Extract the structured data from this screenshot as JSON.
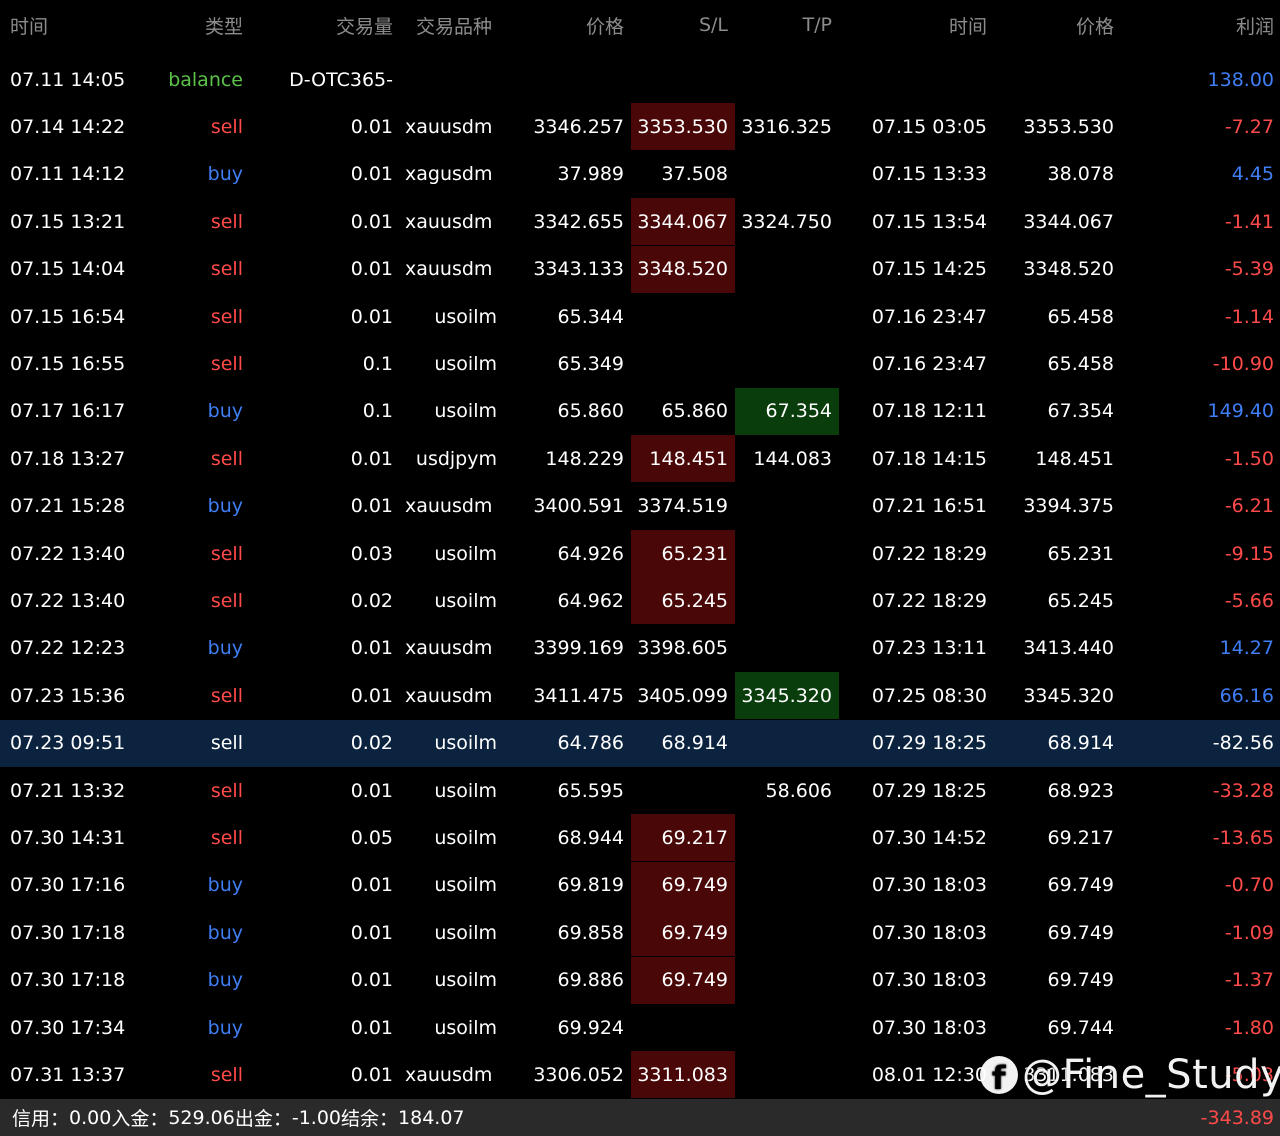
{
  "headers": {
    "time": "时间",
    "type": "类型",
    "volume": "交易量",
    "symbol": "交易品种",
    "price": "价格",
    "sl": "S/L",
    "tp": "T/P",
    "close_time": "时间",
    "close_price": "价格",
    "profit": "利润"
  },
  "colors": {
    "sell": "#ff4a4a",
    "buy": "#3f7ef5",
    "balance": "#5cc24a",
    "sl_highlight": "#4a0707",
    "tp_highlight": "#093d0c",
    "selected_row": "#0c2340"
  },
  "rows": [
    {
      "time": "07.11 14:05",
      "type": "balance",
      "volume": "",
      "symbol": "D-OTC365-",
      "price": "",
      "sl": "",
      "tp": "",
      "close_time": "",
      "close_price": "",
      "profit": "138.00",
      "type_color": "balance",
      "profit_color": "pos",
      "sl_hl": "",
      "tp_hl": "",
      "symbol_align": "right"
    },
    {
      "time": "07.14 14:22",
      "type": "sell",
      "volume": "0.01",
      "symbol": "xauusdm",
      "price": "3346.257",
      "sl": "3353.530",
      "tp": "3316.325",
      "close_time": "07.15 03:05",
      "close_price": "3353.530",
      "profit": "-7.27",
      "type_color": "sell",
      "profit_color": "neg",
      "sl_hl": "red",
      "tp_hl": "",
      "symbol_align": "left"
    },
    {
      "time": "07.11 14:12",
      "type": "buy",
      "volume": "0.01",
      "symbol": "xagusdm",
      "price": "37.989",
      "sl": "37.508",
      "tp": "",
      "close_time": "07.15 13:33",
      "close_price": "38.078",
      "profit": "4.45",
      "type_color": "buy",
      "profit_color": "pos",
      "sl_hl": "",
      "tp_hl": "",
      "symbol_align": "left"
    },
    {
      "time": "07.15 13:21",
      "type": "sell",
      "volume": "0.01",
      "symbol": "xauusdm",
      "price": "3342.655",
      "sl": "3344.067",
      "tp": "3324.750",
      "close_time": "07.15 13:54",
      "close_price": "3344.067",
      "profit": "-1.41",
      "type_color": "sell",
      "profit_color": "neg",
      "sl_hl": "red",
      "tp_hl": "",
      "symbol_align": "left"
    },
    {
      "time": "07.15 14:04",
      "type": "sell",
      "volume": "0.01",
      "symbol": "xauusdm",
      "price": "3343.133",
      "sl": "3348.520",
      "tp": "",
      "close_time": "07.15 14:25",
      "close_price": "3348.520",
      "profit": "-5.39",
      "type_color": "sell",
      "profit_color": "neg",
      "sl_hl": "red",
      "tp_hl": "",
      "symbol_align": "left"
    },
    {
      "time": "07.15 16:54",
      "type": "sell",
      "volume": "0.01",
      "symbol": "usoilm",
      "price": "65.344",
      "sl": "",
      "tp": "",
      "close_time": "07.16 23:47",
      "close_price": "65.458",
      "profit": "-1.14",
      "type_color": "sell",
      "profit_color": "neg",
      "sl_hl": "",
      "tp_hl": "",
      "symbol_align": "right"
    },
    {
      "time": "07.15 16:55",
      "type": "sell",
      "volume": "0.1",
      "symbol": "usoilm",
      "price": "65.349",
      "sl": "",
      "tp": "",
      "close_time": "07.16 23:47",
      "close_price": "65.458",
      "profit": "-10.90",
      "type_color": "sell",
      "profit_color": "neg",
      "sl_hl": "",
      "tp_hl": "",
      "symbol_align": "right"
    },
    {
      "time": "07.17 16:17",
      "type": "buy",
      "volume": "0.1",
      "symbol": "usoilm",
      "price": "65.860",
      "sl": "65.860",
      "tp": "67.354",
      "close_time": "07.18 12:11",
      "close_price": "67.354",
      "profit": "149.40",
      "type_color": "buy",
      "profit_color": "pos",
      "sl_hl": "",
      "tp_hl": "green",
      "symbol_align": "right"
    },
    {
      "time": "07.18 13:27",
      "type": "sell",
      "volume": "0.01",
      "symbol": "usdjpym",
      "price": "148.229",
      "sl": "148.451",
      "tp": "144.083",
      "close_time": "07.18 14:15",
      "close_price": "148.451",
      "profit": "-1.50",
      "type_color": "sell",
      "profit_color": "neg",
      "sl_hl": "red",
      "tp_hl": "",
      "symbol_align": "right"
    },
    {
      "time": "07.21 15:28",
      "type": "buy",
      "volume": "0.01",
      "symbol": "xauusdm",
      "price": "3400.591",
      "sl": "3374.519",
      "tp": "",
      "close_time": "07.21 16:51",
      "close_price": "3394.375",
      "profit": "-6.21",
      "type_color": "buy",
      "profit_color": "neg",
      "sl_hl": "",
      "tp_hl": "",
      "symbol_align": "left"
    },
    {
      "time": "07.22 13:40",
      "type": "sell",
      "volume": "0.03",
      "symbol": "usoilm",
      "price": "64.926",
      "sl": "65.231",
      "tp": "",
      "close_time": "07.22 18:29",
      "close_price": "65.231",
      "profit": "-9.15",
      "type_color": "sell",
      "profit_color": "neg",
      "sl_hl": "red",
      "tp_hl": "",
      "symbol_align": "right"
    },
    {
      "time": "07.22 13:40",
      "type": "sell",
      "volume": "0.02",
      "symbol": "usoilm",
      "price": "64.962",
      "sl": "65.245",
      "tp": "",
      "close_time": "07.22 18:29",
      "close_price": "65.245",
      "profit": "-5.66",
      "type_color": "sell",
      "profit_color": "neg",
      "sl_hl": "red",
      "tp_hl": "",
      "symbol_align": "right"
    },
    {
      "time": "07.22 12:23",
      "type": "buy",
      "volume": "0.01",
      "symbol": "xauusdm",
      "price": "3399.169",
      "sl": "3398.605",
      "tp": "",
      "close_time": "07.23 13:11",
      "close_price": "3413.440",
      "profit": "14.27",
      "type_color": "buy",
      "profit_color": "pos",
      "sl_hl": "",
      "tp_hl": "",
      "symbol_align": "left"
    },
    {
      "time": "07.23 15:36",
      "type": "sell",
      "volume": "0.01",
      "symbol": "xauusdm",
      "price": "3411.475",
      "sl": "3405.099",
      "tp": "3345.320",
      "close_time": "07.25 08:30",
      "close_price": "3345.320",
      "profit": "66.16",
      "type_color": "sell",
      "profit_color": "pos",
      "sl_hl": "",
      "tp_hl": "green",
      "symbol_align": "left"
    },
    {
      "time": "07.23 09:51",
      "type": "sell",
      "volume": "0.02",
      "symbol": "usoilm",
      "price": "64.786",
      "sl": "68.914",
      "tp": "",
      "close_time": "07.29 18:25",
      "close_price": "68.914",
      "profit": "-82.56",
      "type_color": "white",
      "profit_color": "white",
      "sl_hl": "",
      "tp_hl": "",
      "symbol_align": "right",
      "selected": true
    },
    {
      "time": "07.21 13:32",
      "type": "sell",
      "volume": "0.01",
      "symbol": "usoilm",
      "price": "65.595",
      "sl": "",
      "tp": "58.606",
      "close_time": "07.29 18:25",
      "close_price": "68.923",
      "profit": "-33.28",
      "type_color": "sell",
      "profit_color": "neg",
      "sl_hl": "",
      "tp_hl": "",
      "symbol_align": "right"
    },
    {
      "time": "07.30 14:31",
      "type": "sell",
      "volume": "0.05",
      "symbol": "usoilm",
      "price": "68.944",
      "sl": "69.217",
      "tp": "",
      "close_time": "07.30 14:52",
      "close_price": "69.217",
      "profit": "-13.65",
      "type_color": "sell",
      "profit_color": "neg",
      "sl_hl": "red",
      "tp_hl": "",
      "symbol_align": "right"
    },
    {
      "time": "07.30 17:16",
      "type": "buy",
      "volume": "0.01",
      "symbol": "usoilm",
      "price": "69.819",
      "sl": "69.749",
      "tp": "",
      "close_time": "07.30 18:03",
      "close_price": "69.749",
      "profit": "-0.70",
      "type_color": "buy",
      "profit_color": "neg",
      "sl_hl": "red",
      "tp_hl": "",
      "symbol_align": "right"
    },
    {
      "time": "07.30 17:18",
      "type": "buy",
      "volume": "0.01",
      "symbol": "usoilm",
      "price": "69.858",
      "sl": "69.749",
      "tp": "",
      "close_time": "07.30 18:03",
      "close_price": "69.749",
      "profit": "-1.09",
      "type_color": "buy",
      "profit_color": "neg",
      "sl_hl": "red",
      "tp_hl": "",
      "symbol_align": "right"
    },
    {
      "time": "07.30 17:18",
      "type": "buy",
      "volume": "0.01",
      "symbol": "usoilm",
      "price": "69.886",
      "sl": "69.749",
      "tp": "",
      "close_time": "07.30 18:03",
      "close_price": "69.749",
      "profit": "-1.37",
      "type_color": "buy",
      "profit_color": "neg",
      "sl_hl": "red",
      "tp_hl": "",
      "symbol_align": "right"
    },
    {
      "time": "07.30 17:34",
      "type": "buy",
      "volume": "0.01",
      "symbol": "usoilm",
      "price": "69.924",
      "sl": "",
      "tp": "",
      "close_time": "07.30 18:03",
      "close_price": "69.744",
      "profit": "-1.80",
      "type_color": "buy",
      "profit_color": "neg",
      "sl_hl": "",
      "tp_hl": "",
      "symbol_align": "right"
    },
    {
      "time": "07.31 13:37",
      "type": "sell",
      "volume": "0.01",
      "symbol": "xauusdm",
      "price": "3306.052",
      "sl": "3311.083",
      "tp": "",
      "close_time": "08.01 12:30",
      "close_price": "3311.083",
      "profit": "-5.03",
      "type_color": "sell",
      "profit_color": "neg",
      "sl_hl": "red",
      "tp_hl": "",
      "symbol_align": "left"
    }
  ],
  "footer": {
    "credit_label": "信用：",
    "credit_value": "0.00",
    "deposit_label": "入金：",
    "deposit_value": "529.06",
    "withdraw_label": "出金：",
    "withdraw_value": "-1.00",
    "balance_label": "结余：",
    "balance_value": "184.07",
    "total_profit": "-343.89"
  },
  "watermark": {
    "icon": "facebook-icon",
    "text": "@Fine_Study"
  }
}
